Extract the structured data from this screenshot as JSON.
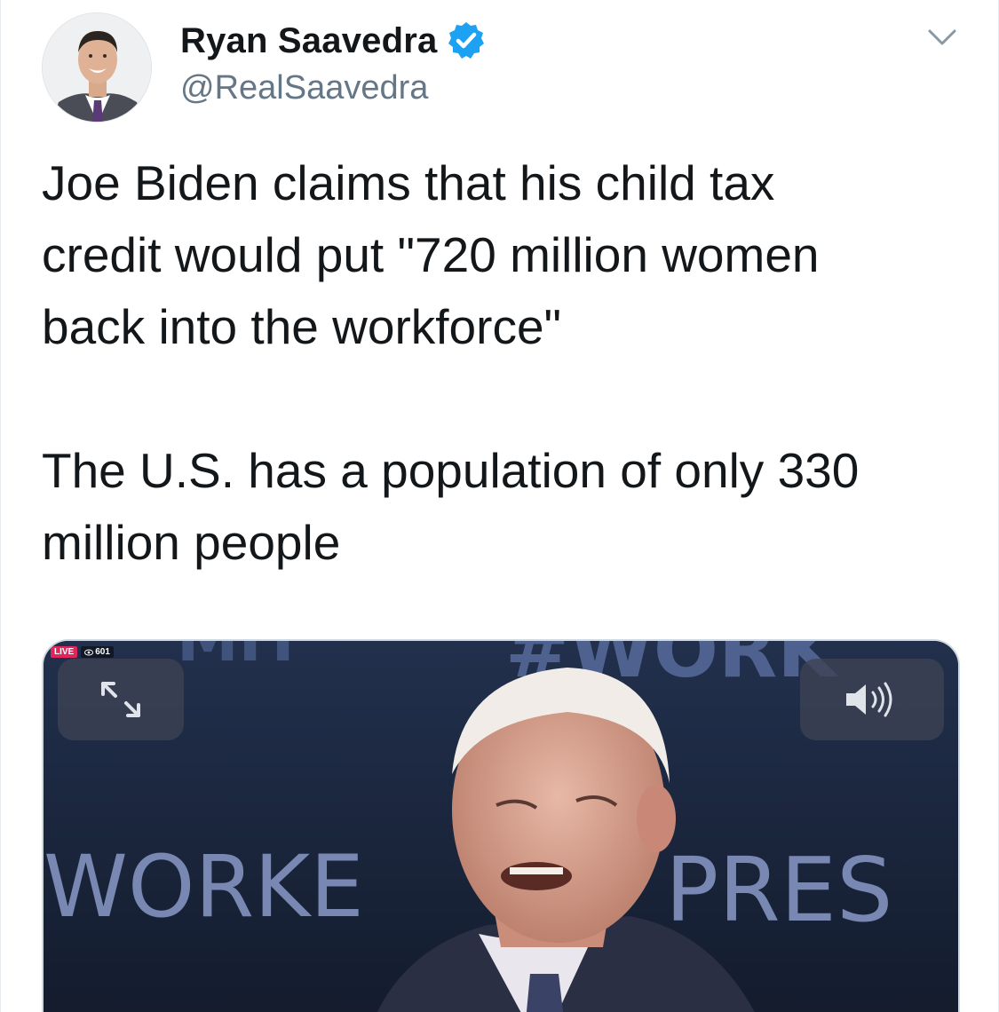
{
  "author": {
    "display_name": "Ryan Saavedra",
    "handle": "@RealSaavedra",
    "verified": true,
    "verified_color": "#1da1f2"
  },
  "tweet": {
    "paragraph_1": [
      "Joe Biden claims that his child tax",
      "credit would put \"720 million women",
      "back into the workforce\""
    ],
    "paragraph_2": [
      "The U.S. has a population of only 330",
      "million people"
    ]
  },
  "media": {
    "type": "video",
    "live_badge": "LIVE",
    "viewer_count": "601",
    "background_text_top": "#WORK",
    "background_text_left": "WORKE",
    "background_text_right": "PRES",
    "controls": {
      "expand_icon": "expand-arrows-icon",
      "volume_icon": "speaker-volume-icon"
    }
  },
  "icons": {
    "menu": "chevron-down-icon"
  },
  "colors": {
    "text_primary": "#14171a",
    "text_secondary": "#657786",
    "accent": "#1da1f2"
  }
}
